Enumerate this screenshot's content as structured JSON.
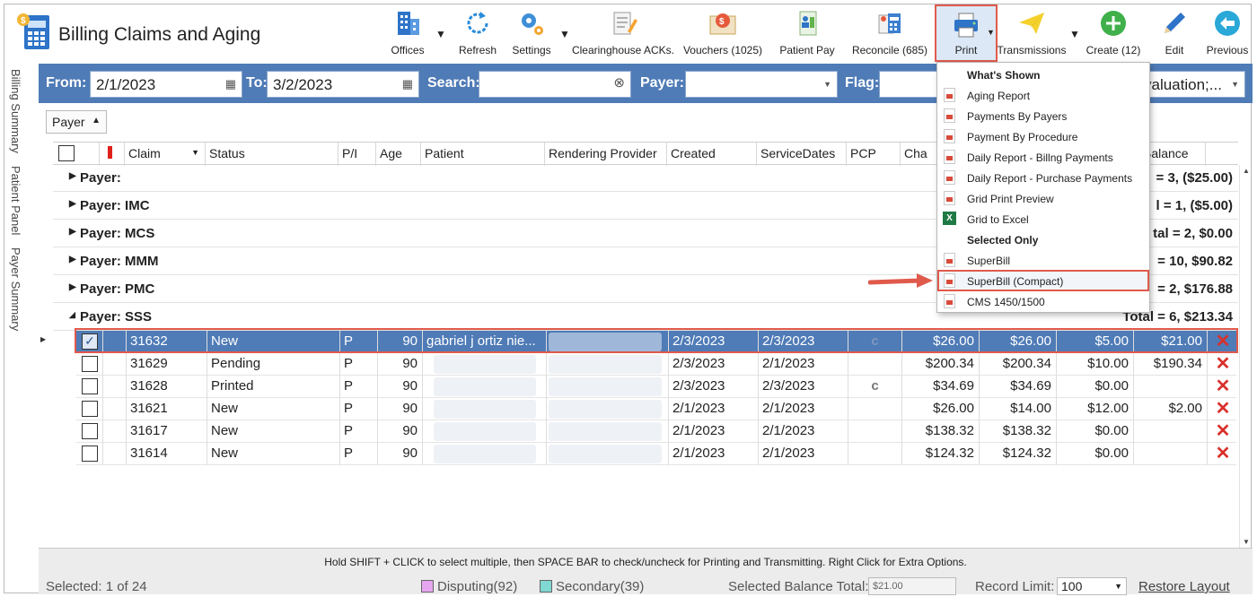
{
  "app": {
    "title": "Billing Claims and Aging"
  },
  "toolbar": {
    "offices": "Offices",
    "refresh": "Refresh",
    "settings": "Settings",
    "clearinghouse": "Clearinghouse ACKs.",
    "vouchers": "Vouchers (1025)",
    "patient_pay": "Patient Pay",
    "reconcile": "Reconcile (685)",
    "print": "Print",
    "transmissions": "Transmissions",
    "create": "Create (12)",
    "edit": "Edit",
    "previous": "Previous"
  },
  "side_tabs": [
    "Billing Summary",
    "Patient Panel",
    "Payer Summary"
  ],
  "filters": {
    "from_label": "From:",
    "from_value": "2/1/2023",
    "to_label": "To:",
    "to_value": "3/2/2023",
    "search_label": "Search:",
    "search_value": "",
    "payer_label": "Payer:",
    "payer_value": "",
    "flag_label": "Flag:",
    "extra_value": "valuation;..."
  },
  "group_chip": "Payer",
  "columns": {
    "claim": "Claim",
    "status": "Status",
    "pi": "P/I",
    "age": "Age",
    "patient": "Patient",
    "rendering": "Rendering Provider",
    "created": "Created",
    "service": "ServiceDates",
    "pcp": "PCP",
    "charges": "Cha",
    "balance": "Balance"
  },
  "groups": [
    {
      "label": "Payer:",
      "total": "= 3,  ($25.00)"
    },
    {
      "label": "Payer: IMC",
      "total": "l = 1,  ($5.00)"
    },
    {
      "label": "Payer: MCS",
      "total": "tal = 2,  $0.00"
    },
    {
      "label": "Payer: MMM",
      "total": "= 10,  $90.82"
    },
    {
      "label": "Payer: PMC",
      "total": "= 2,  $176.88"
    },
    {
      "label": "Payer: SSS",
      "total": "Total = 6,  $213.34"
    }
  ],
  "rows": [
    {
      "claim": "31632",
      "status": "New",
      "pi": "P",
      "age": "90",
      "patient": "gabriel j ortiz nie...",
      "created": "2/3/2023",
      "service": "2/3/2023",
      "pcp": "c",
      "charges": "$26.00",
      "col2": "$26.00",
      "col3": "$5.00",
      "balance": "$21.00",
      "selected": true
    },
    {
      "claim": "31629",
      "status": "Pending",
      "pi": "P",
      "age": "90",
      "patient": "",
      "created": "2/3/2023",
      "service": "2/1/2023",
      "pcp": "",
      "charges": "$200.34",
      "col2": "$200.34",
      "col3": "$10.00",
      "balance": "$190.34",
      "selected": false
    },
    {
      "claim": "31628",
      "status": "Printed",
      "pi": "P",
      "age": "90",
      "patient": "",
      "created": "2/3/2023",
      "service": "2/3/2023",
      "pcp": "c",
      "charges": "$34.69",
      "col2": "$34.69",
      "col3": "$0.00",
      "balance": "",
      "selected": false
    },
    {
      "claim": "31621",
      "status": "New",
      "pi": "P",
      "age": "90",
      "patient": "",
      "created": "2/1/2023",
      "service": "2/1/2023",
      "pcp": "",
      "charges": "$26.00",
      "col2": "$14.00",
      "col3": "$12.00",
      "balance": "$2.00",
      "selected": false
    },
    {
      "claim": "31617",
      "status": "New",
      "pi": "P",
      "age": "90",
      "patient": "",
      "created": "2/1/2023",
      "service": "2/1/2023",
      "pcp": "",
      "charges": "$138.32",
      "col2": "$138.32",
      "col3": "$0.00",
      "balance": "",
      "selected": false
    },
    {
      "claim": "31614",
      "status": "New",
      "pi": "P",
      "age": "90",
      "patient": "",
      "created": "2/1/2023",
      "service": "2/1/2023",
      "pcp": "",
      "charges": "$124.32",
      "col2": "$124.32",
      "col3": "$0.00",
      "balance": "",
      "selected": false
    }
  ],
  "print_menu": {
    "section1": "What's Shown",
    "items1": [
      "Aging Report",
      "Payments By Payers",
      "Payment By Procedure",
      "Daily Report - Billng Payments",
      "Daily Report - Purchase Payments",
      "Grid Print Preview",
      "Grid to Excel"
    ],
    "section2": "Selected Only",
    "items2": [
      "SuperBill",
      "SuperBill (Compact)",
      "CMS 1450/1500"
    ]
  },
  "status": {
    "hint": "Hold SHIFT + CLICK to select multiple, then SPACE BAR to check/uncheck for Printing and Transmitting. Right Click for Extra Options.",
    "selected": "Selected: 1 of 24",
    "disputing": "Disputing(92)",
    "secondary": "Secondary(39)",
    "balance_label": "Selected Balance Total:",
    "balance_value": "$21.00",
    "record_limit_label": "Record Limit:",
    "record_limit_value": "100",
    "restore": "Restore Layout"
  },
  "colors": {
    "accent": "#4f7bb6",
    "highlight": "#e05a4c",
    "disputing": "#e6a6ef",
    "secondary": "#7fd8d1",
    "delete": "#d9302c"
  }
}
